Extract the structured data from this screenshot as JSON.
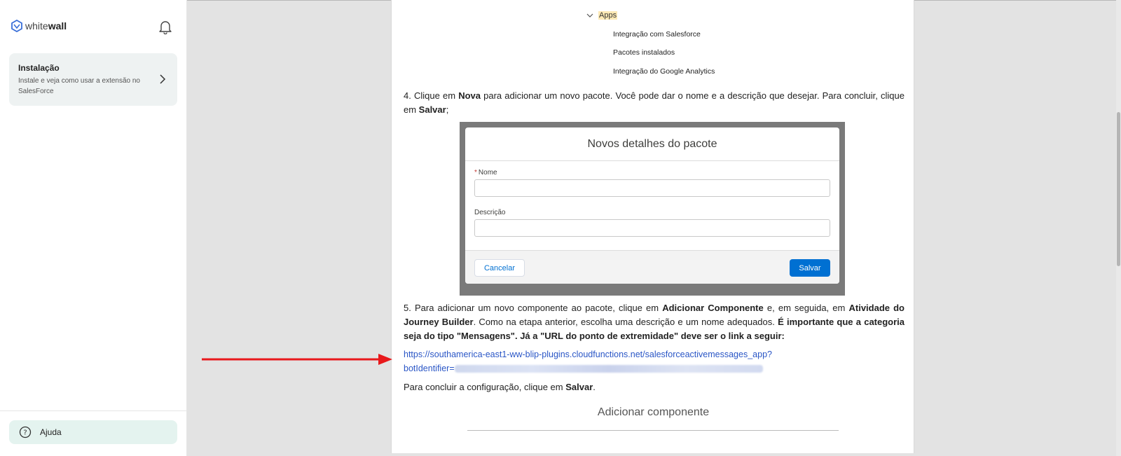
{
  "sidebar": {
    "brand_light": "white",
    "brand_bold": "wall",
    "nav_card": {
      "title": "Instalação",
      "description": "Instale e veja como usar a extensão no SalesForce"
    },
    "help_label": "Ajuda"
  },
  "doc": {
    "tree": {
      "apps_label": "Apps",
      "items": [
        "Integração com Salesforce",
        "Pacotes instalados",
        "Integração do Google Analytics"
      ]
    },
    "step4": {
      "t1": "4. Clique em ",
      "b1": "Nova",
      "t2": " para adicionar um novo pacote. Você pode dar o nome e a descrição que desejar. Para concluir, clique em ",
      "b2": "Salvar",
      "t3": ";"
    },
    "modal": {
      "title": "Novos detalhes do pacote",
      "required_mark": "*",
      "name_label": "Nome",
      "description_label": "Descrição",
      "cancel_button": "Cancelar",
      "save_button": "Salvar"
    },
    "step5": {
      "t1": "5. Para adicionar um novo componente ao pacote, clique em ",
      "b1": "Adicionar Componente",
      "t2": " e, em seguida, em ",
      "b2": "Atividade do Journey Builder",
      "t3": ". Como na etapa anterior, escolha uma descrição e um nome adequados. ",
      "b3": "É importante que a categoria seja do tipo \"Mensagens\". Já a \"URL do ponto de extremidade\" deve ser o link a seguir:"
    },
    "link": {
      "line1": "https://southamerica-east1-ww-blip-plugins.cloudfunctions.net/salesforceactivemessages_app?",
      "line2_prefix": "botIdentifier="
    },
    "conclude": {
      "t1": "Para concluir a configuração, clique em ",
      "b1": "Salvar",
      "t2": "."
    },
    "next_heading": "Adicionar componente"
  },
  "colors": {
    "link": "#2a56c6",
    "save_button": "#0070d2",
    "arrow": "#e8191c",
    "help_bg": "#e4f3ef",
    "highlight": "#fde9b5"
  }
}
